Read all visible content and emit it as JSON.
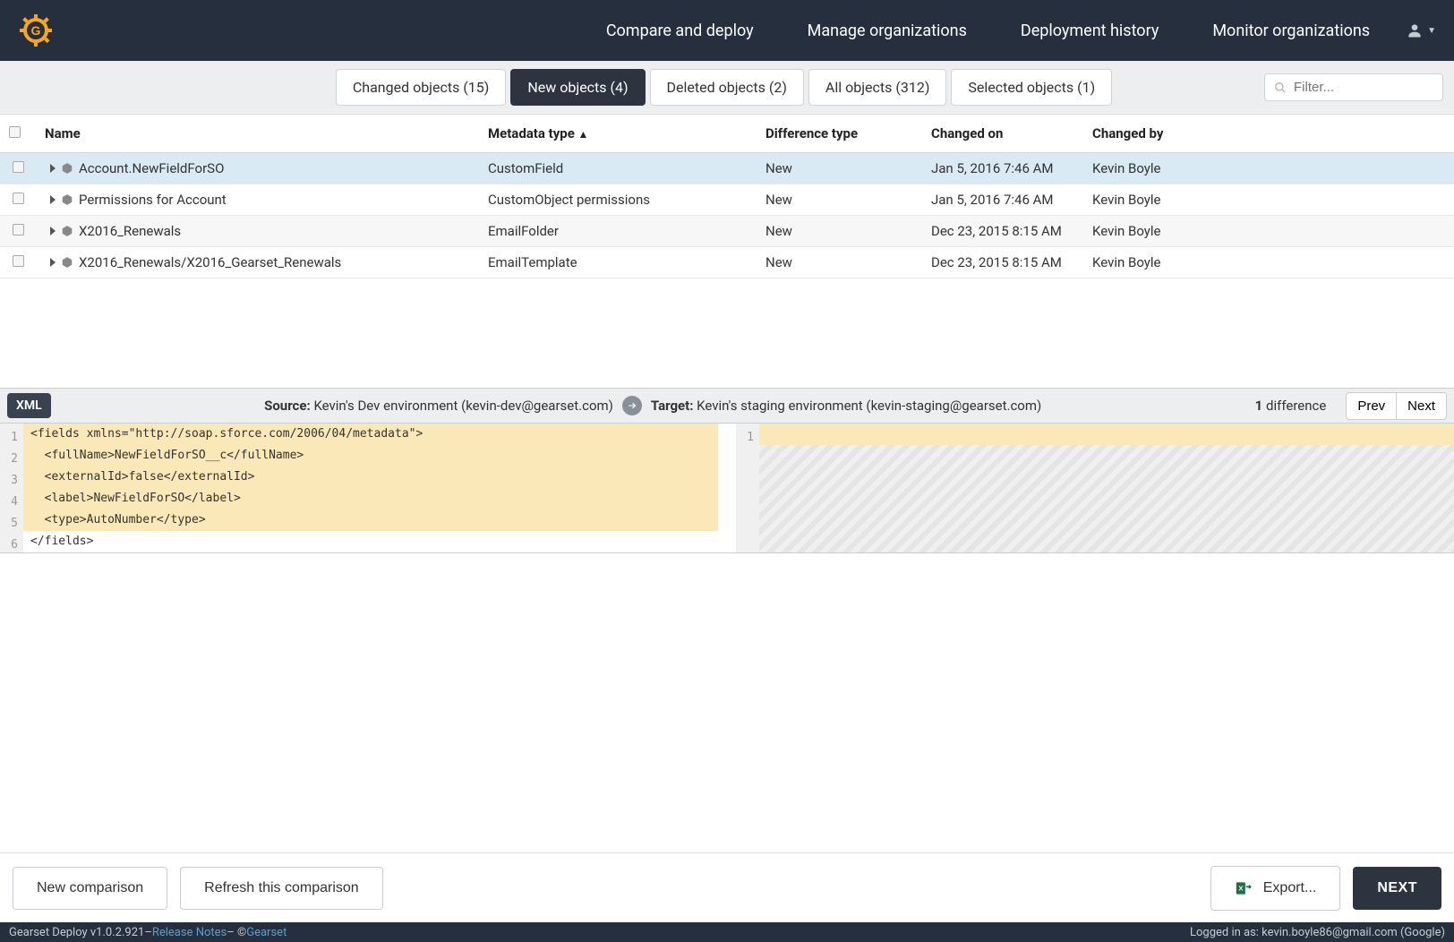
{
  "nav": {
    "items": [
      "Compare and deploy",
      "Manage organizations",
      "Deployment history",
      "Monitor organizations"
    ]
  },
  "tabs": [
    {
      "label": "Changed objects (15)",
      "active": false
    },
    {
      "label": "New objects (4)",
      "active": true
    },
    {
      "label": "Deleted objects (2)",
      "active": false
    },
    {
      "label": "All objects (312)",
      "active": false
    },
    {
      "label": "Selected objects (1)",
      "active": false
    }
  ],
  "filter": {
    "placeholder": "Filter..."
  },
  "columns": {
    "name": "Name",
    "metatype": "Metadata type",
    "sort_indicator": "▲",
    "difftype": "Difference type",
    "changed_on": "Changed on",
    "changed_by": "Changed by"
  },
  "rows": [
    {
      "name": "Account.NewFieldForSO",
      "metatype": "CustomField",
      "difftype": "New",
      "changed_on": "Jan 5, 2016 7:46 AM",
      "changed_by": "Kevin Boyle",
      "selected": true
    },
    {
      "name": "Permissions for Account",
      "metatype": "CustomObject permissions",
      "difftype": "New",
      "changed_on": "Jan 5, 2016 7:46 AM",
      "changed_by": "Kevin Boyle",
      "selected": false
    },
    {
      "name": "X2016_Renewals",
      "metatype": "EmailFolder",
      "difftype": "New",
      "changed_on": "Dec 23, 2015 8:15 AM",
      "changed_by": "Kevin Boyle",
      "selected": false
    },
    {
      "name": "X2016_Renewals/X2016_Gearset_Renewals",
      "metatype": "EmailTemplate",
      "difftype": "New",
      "changed_on": "Dec 23, 2015 8:15 AM",
      "changed_by": "Kevin Boyle",
      "selected": false
    }
  ],
  "diffbar": {
    "xml": "XML",
    "source_label": "Source:",
    "source_value": "Kevin's Dev environment (kevin-dev@gearset.com)",
    "target_label": "Target:",
    "target_value": "Kevin's staging environment (kevin-staging@gearset.com)",
    "diff_count_num": "1",
    "diff_count_word": "difference",
    "prev": "Prev",
    "next": "Next"
  },
  "source_lines": [
    "<fields xmlns=\"http://soap.sforce.com/2006/04/metadata\">",
    "  <fullName>NewFieldForSO__c</fullName>",
    "  <externalId>false</externalId>",
    "  <label>NewFieldForSO</label>",
    "  <type>AutoNumber</type>",
    "</fields>"
  ],
  "target_line_numbers": [
    "1"
  ],
  "actions": {
    "new_comparison": "New comparison",
    "refresh": "Refresh this comparison",
    "export": "Export...",
    "next": "NEXT"
  },
  "footer": {
    "version": "Gearset Deploy v1.0.2.921",
    "sep1": " – ",
    "release_notes": "Release Notes",
    "sep2": " – © ",
    "brand": "Gearset",
    "logged_in_prefix": "Logged in as: ",
    "logged_in_value": "kevin.boyle86@gmail.com (Google)"
  }
}
